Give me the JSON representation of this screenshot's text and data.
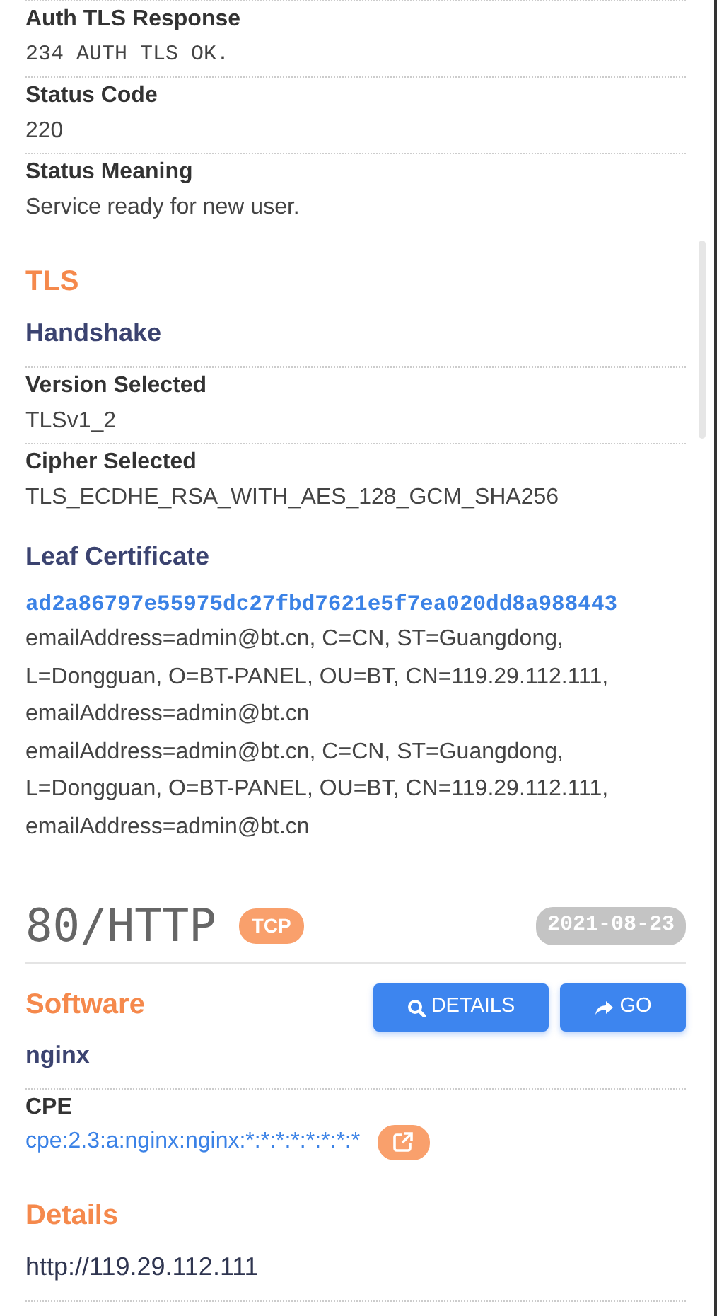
{
  "top_fields": [
    {
      "label": "Auth TLS Response",
      "value": "234 AUTH TLS OK.",
      "kind": "code"
    },
    {
      "label": "Status Code",
      "value": "220",
      "kind": "text"
    },
    {
      "label": "Status Meaning",
      "value": "Service ready for new user.",
      "kind": "text"
    }
  ],
  "tls": {
    "title": "TLS",
    "handshake": {
      "title": "Handshake",
      "fields": [
        {
          "label": "Version Selected",
          "value": "TLSv1_2",
          "kind": "text"
        },
        {
          "label": "Cipher Selected",
          "value": "TLS_ECDHE_RSA_WITH_AES_128_GCM_SHA256",
          "kind": "text"
        }
      ]
    },
    "leaf_certificate": {
      "title": "Leaf Certificate",
      "fingerprint": "ad2a86797e55975dc27fbd7621e5f7ea020dd8a988443",
      "lines": [
        "emailAddress=admin@bt.cn, C=CN, ST=Guangdong, L=Dongguan, O=BT-PANEL, OU=BT, CN=119.29.112.111, emailAddress=admin@bt.cn",
        "emailAddress=admin@bt.cn, C=CN, ST=Guangdong, L=Dongguan, O=BT-PANEL, OU=BT, CN=119.29.112.111, emailAddress=admin@bt.cn"
      ]
    }
  },
  "port": {
    "title": "80/HTTP",
    "protocol": "TCP",
    "date": "2021-08-23",
    "software": {
      "title": "Software",
      "name": "nginx",
      "buttons": [
        {
          "label": "DETAILS"
        },
        {
          "label": "GO"
        }
      ],
      "cpe_label": "CPE",
      "cpe": "cpe:2.3:a:nginx:nginx:*:*:*:*:*:*:*:*"
    },
    "details": {
      "title": "Details",
      "url": "http://119.29.112.111"
    }
  }
}
